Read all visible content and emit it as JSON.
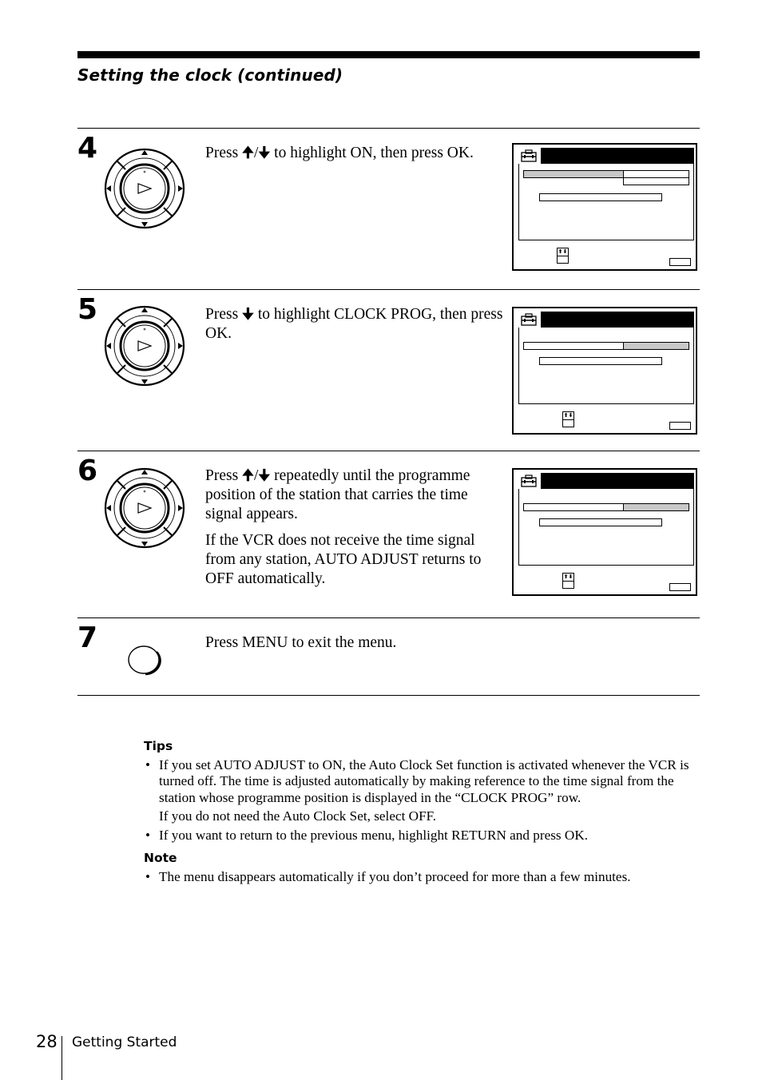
{
  "header": {
    "title": "Setting the clock (continued)"
  },
  "steps": [
    {
      "number": "4",
      "control": "jog-dial",
      "paragraphs": [
        {
          "before": "Press ",
          "arrows": "up-down",
          "after": " to highlight ON, then press OK."
        }
      ],
      "osd": {
        "highlight": "left-row-1"
      }
    },
    {
      "number": "5",
      "control": "jog-dial",
      "paragraphs": [
        {
          "before": "Press ",
          "arrows": "down",
          "after": " to highlight CLOCK PROG, then press OK."
        }
      ],
      "osd": {
        "highlight": "right-row-2"
      }
    },
    {
      "number": "6",
      "control": "jog-dial",
      "paragraphs": [
        {
          "before": "Press ",
          "arrows": "up-down",
          "after": " repeatedly until the programme position of the station that carries the time signal appears."
        },
        {
          "text": "If the VCR does not receive the time signal from any station, AUTO ADJUST returns to OFF automatically."
        }
      ],
      "osd": {
        "highlight": "right-row-2"
      }
    },
    {
      "number": "7",
      "control": "menu-button",
      "paragraphs": [
        {
          "text": "Press MENU to exit the menu."
        }
      ]
    }
  ],
  "glyphs": {
    "up": "🠉",
    "down": "🠋",
    "slash": "/",
    "up_down_small": "⬆⬇"
  },
  "tips": {
    "heading": "Tips",
    "items": [
      {
        "text": "If you set AUTO ADJUST to ON, the Auto Clock Set function is activated whenever the VCR is turned off. The time is adjusted automatically by making reference to the time signal from the station whose programme position is displayed in the “CLOCK PROG” row.",
        "sub": "If you do not need the Auto Clock Set, select OFF."
      },
      {
        "text": "If you want to return to the previous menu, highlight RETURN and press OK."
      }
    ]
  },
  "note": {
    "heading": "Note",
    "items": [
      {
        "text": "The menu disappears automatically if you don’t proceed for more than a few minutes."
      }
    ]
  },
  "footer": {
    "page_number": "28",
    "section": "Getting Started"
  },
  "colors": {
    "highlight": "#c8c8c8",
    "ink": "#000000"
  }
}
